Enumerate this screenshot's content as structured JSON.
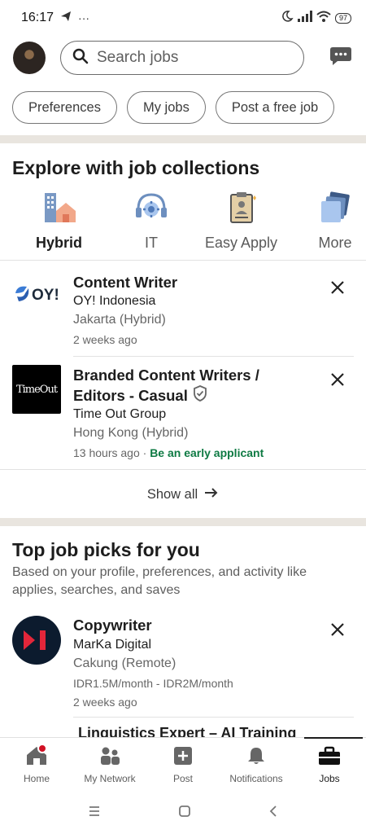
{
  "status": {
    "time": "16:17",
    "battery": "97"
  },
  "search": {
    "placeholder": "Search jobs"
  },
  "chips": [
    "Preferences",
    "My jobs",
    "Post a free job"
  ],
  "collections": {
    "title": "Explore with job collections",
    "items": [
      {
        "label": "Hybrid",
        "icon": "hybrid-icon",
        "active": true
      },
      {
        "label": "IT",
        "icon": "it-icon",
        "active": false
      },
      {
        "label": "Easy Apply",
        "icon": "easy-apply-icon",
        "active": false
      },
      {
        "label": "More",
        "icon": "more-icon",
        "active": false
      }
    ]
  },
  "jobs": [
    {
      "title": "Content Writer",
      "company": "OY! Indonesia",
      "location": "Jakarta (Hybrid)",
      "posted": "2 weeks ago",
      "logo_text": "OY!"
    },
    {
      "title_line1": "Branded Content Writers /",
      "title_line2": "Editors - Casual",
      "company": "Time Out Group",
      "location": "Hong Kong (Hybrid)",
      "posted": "13 hours ago",
      "separator": " · ",
      "badge": "Be an early applicant",
      "logo_text": "TimeOut"
    }
  ],
  "show_all": "Show all",
  "top_picks": {
    "title": "Top job picks for you",
    "subtitle": "Based on your profile, preferences, and activity like applies, searches, and saves",
    "jobs": [
      {
        "title": "Copywriter",
        "company": "MarKa Digital",
        "location": "Cakung (Remote)",
        "salary": "IDR1.5M/month - IDR2M/month",
        "posted": "2 weeks ago"
      }
    ],
    "peek_title": "Linguistics Expert – AI Training"
  },
  "nav": [
    {
      "label": "Home",
      "icon": "home-icon"
    },
    {
      "label": "My Network",
      "icon": "network-icon"
    },
    {
      "label": "Post",
      "icon": "post-icon"
    },
    {
      "label": "Notifications",
      "icon": "bell-icon"
    },
    {
      "label": "Jobs",
      "icon": "briefcase-icon"
    }
  ],
  "colors": {
    "accent_green": "#0e7a43",
    "divider": "#e9e5df",
    "notif": "#d11124"
  }
}
